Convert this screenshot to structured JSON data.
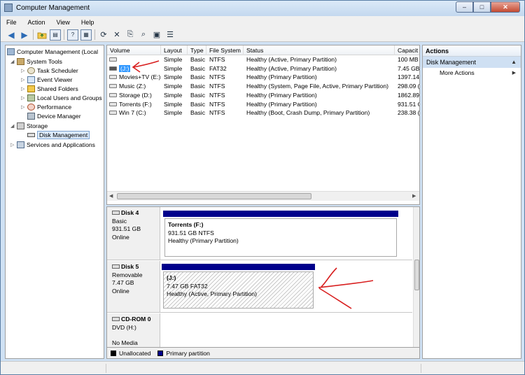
{
  "window": {
    "title": "Computer Management",
    "buttons": {
      "minimize": "–",
      "maximize": "□",
      "close": "✕"
    }
  },
  "menu": [
    "File",
    "Action",
    "View",
    "Help"
  ],
  "toolbar": {
    "icons": [
      "back-arrow-icon",
      "forward-arrow-icon",
      "up-folder-icon",
      "console-tree-icon",
      "help-icon",
      "properties-icon",
      "refresh-icon",
      "delete-icon",
      "export-icon",
      "find-icon",
      "wizard-icon"
    ]
  },
  "tree": {
    "items": [
      {
        "label": "Computer Management (Local",
        "level": 0,
        "expander": ""
      },
      {
        "label": "System Tools",
        "level": 1,
        "expander": "◢"
      },
      {
        "label": "Task Scheduler",
        "level": 2,
        "expander": "▷"
      },
      {
        "label": "Event Viewer",
        "level": 2,
        "expander": "▷"
      },
      {
        "label": "Shared Folders",
        "level": 2,
        "expander": "▷"
      },
      {
        "label": "Local Users and Groups",
        "level": 2,
        "expander": "▷"
      },
      {
        "label": "Performance",
        "level": 2,
        "expander": "▷"
      },
      {
        "label": "Device Manager",
        "level": 2,
        "expander": ""
      },
      {
        "label": "Storage",
        "level": 1,
        "expander": "◢"
      },
      {
        "label": "Disk Management",
        "level": 2,
        "expander": "",
        "selected": true
      },
      {
        "label": "Services and Applications",
        "level": 1,
        "expander": "▷"
      }
    ]
  },
  "volumes": {
    "columns": [
      "Volume",
      "Layout",
      "Type",
      "File System",
      "Status",
      "Capacit"
    ],
    "rows": [
      {
        "volume": "",
        "layout": "Simple",
        "type": "Basic",
        "fs": "NTFS",
        "status": "Healthy (Active, Primary Partition)",
        "capacity": "100 MB"
      },
      {
        "volume": "(J:)",
        "layout": "Simple",
        "type": "Basic",
        "fs": "FAT32",
        "status": "Healthy (Active, Primary Partition)",
        "capacity": "7.45 GB",
        "selected": true
      },
      {
        "volume": "Movies+TV (E:)",
        "layout": "Simple",
        "type": "Basic",
        "fs": "NTFS",
        "status": "Healthy (Primary Partition)",
        "capacity": "1397.14"
      },
      {
        "volume": "Music (Z:)",
        "layout": "Simple",
        "type": "Basic",
        "fs": "NTFS",
        "status": "Healthy (System, Page File, Active, Primary Partition)",
        "capacity": "298.09 ("
      },
      {
        "volume": "Storage (D:)",
        "layout": "Simple",
        "type": "Basic",
        "fs": "NTFS",
        "status": "Healthy (Primary Partition)",
        "capacity": "1862.89"
      },
      {
        "volume": "Torrents (F:)",
        "layout": "Simple",
        "type": "Basic",
        "fs": "NTFS",
        "status": "Healthy (Primary Partition)",
        "capacity": "931.51 G"
      },
      {
        "volume": "Win 7 (C:)",
        "layout": "Simple",
        "type": "Basic",
        "fs": "NTFS",
        "status": "Healthy (Boot, Crash Dump, Primary Partition)",
        "capacity": "238.38 ("
      }
    ]
  },
  "disks": [
    {
      "name": "Disk 4",
      "kind": "Basic",
      "size": "931.51 GB",
      "state": "Online",
      "partition": {
        "name": "Torrents  (F:)",
        "detail": "931.51 GB NTFS",
        "status": "Healthy (Primary Partition)"
      }
    },
    {
      "name": "Disk 5",
      "kind": "Removable",
      "size": "7.47 GB",
      "state": "Online",
      "partition": {
        "name": "(J:)",
        "detail": "7.47 GB FAT32",
        "status": "Healthy (Active, Primary Partition)"
      }
    },
    {
      "name": "CD-ROM 0",
      "kind": "DVD (H:)",
      "size": "",
      "state": "No Media"
    }
  ],
  "legend": [
    {
      "label": "Unallocated",
      "color": "#000000"
    },
    {
      "label": "Primary partition",
      "color": "#00008b"
    }
  ],
  "actions": {
    "header": "Actions",
    "section": "Disk Management",
    "items": [
      "More Actions"
    ]
  },
  "annotations": {
    "color": "#d81f1f"
  }
}
